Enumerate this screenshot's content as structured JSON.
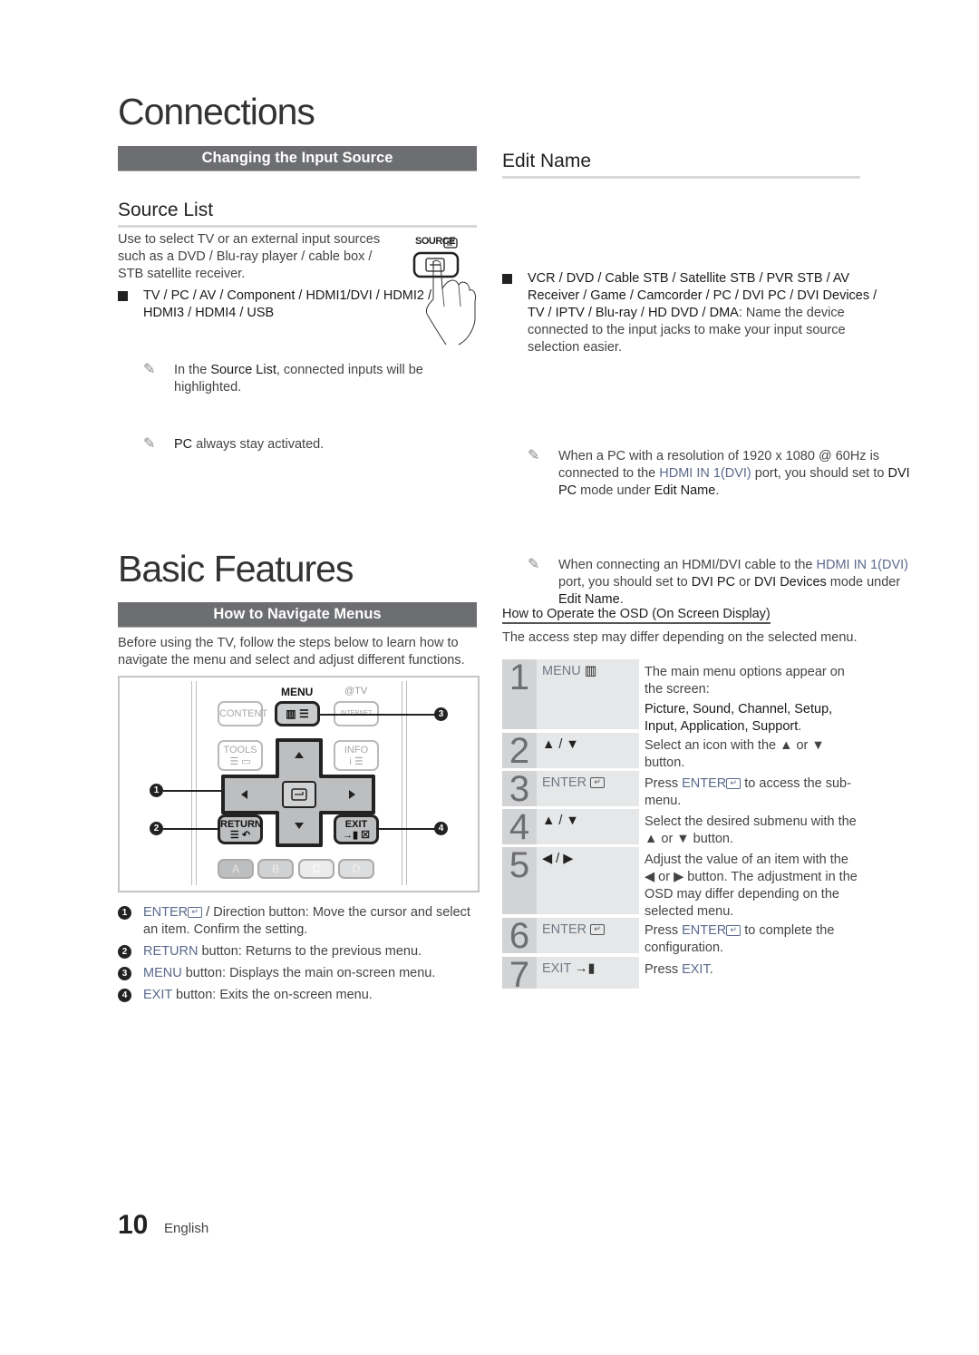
{
  "connections": {
    "title": "Connections",
    "section_bar": "Changing the Input Source",
    "source_list": {
      "heading": "Source List",
      "intro": "Use to select TV or an external input sources such as a DVD / Blu-ray player / cable box / STB satellite receiver.",
      "bullet": "TV / PC / AV / Component / HDMI1/DVI / HDMI2 / HDMI3 / HDMI4 / USB",
      "note1_pre": "In the ",
      "note1_bold": "Source List",
      "note1_post": ", connected inputs will be highlighted.",
      "note2_bold": "PC",
      "note2_post": " always stay activated.",
      "illustration_label": "SOURCE"
    },
    "edit_name": {
      "heading": "Edit Name",
      "bullet_bold": "VCR / DVD / Cable STB / Satellite STB / PVR STB / AV Receiver / Game / Camcorder / PC / DVI PC / DVI Devices / TV / IPTV / Blu-ray / HD DVD / DMA",
      "bullet_post": ": Name the device connected to the input jacks to make your input source selection easier.",
      "note1_a": "When a PC with a resolution of 1920 x 1080 @ 60Hz is connected to the ",
      "note1_port": "HDMI IN 1(DVI)",
      "note1_b": " port, you should set to ",
      "note1_mode": "DVI PC",
      "note1_c": " mode under ",
      "note1_menu": "Edit Name",
      "note1_d": ".",
      "note2_a": "When connecting an HDMI/DVI cable to the ",
      "note2_port": "HDMI IN 1(DVI)",
      "note2_b": " port, you should set to ",
      "note2_mode1": "DVI PC",
      "note2_or": " or ",
      "note2_mode2": "DVI Devices",
      "note2_c": " mode under ",
      "note2_menu": "Edit Name",
      "note2_d": "."
    }
  },
  "basic_features": {
    "title": "Basic Features",
    "section_bar": "How to Navigate Menus",
    "intro": "Before using the TV, follow the steps below to learn how to navigate the menu and select and adjust different functions.",
    "remote": {
      "menu_label": "MENU",
      "attv_label": "@TV",
      "content": "CONTENT",
      "internet": "INTERNET",
      "tools": "TOOLS",
      "info": "INFO",
      "return": "RETURN",
      "exit": "EXIT",
      "color_buttons": [
        "A",
        "B",
        "C",
        "D"
      ],
      "callouts": [
        "1",
        "2",
        "3",
        "4"
      ]
    },
    "legend": [
      {
        "num": "1",
        "key": "ENTER",
        "text": " / Direction button: Move the cursor and select an item. Confirm the setting."
      },
      {
        "num": "2",
        "key": "RETURN",
        "text": " button: Returns to the previous menu."
      },
      {
        "num": "3",
        "key": "MENU",
        "text": " button: Displays the main on-screen menu."
      },
      {
        "num": "4",
        "key": "EXIT",
        "text": " button: Exits the on-screen menu."
      }
    ],
    "osd": {
      "heading": "How to Operate the OSD (On Screen Display)",
      "subtext": "The access step may differ depending on the selected menu.",
      "steps": [
        {
          "num": "1",
          "key": "MENU",
          "desc": "The main menu options appear on the screen:",
          "desc_bold": "Picture, Sound, Channel, Setup, Input, Application, Support",
          "desc_end": "."
        },
        {
          "num": "2",
          "key": "▲ / ▼",
          "desc": "Select an icon with the ▲ or ▼ button."
        },
        {
          "num": "3",
          "key": "ENTER",
          "desc_pre": "Press ",
          "desc_key": "ENTER",
          "desc": " to access the sub-menu."
        },
        {
          "num": "4",
          "key": "▲ / ▼",
          "desc": "Select the desired submenu with the ▲ or ▼ button."
        },
        {
          "num": "5",
          "key": "◀ / ▶",
          "desc": "Adjust the value of an item with the ◀ or ▶ button. The adjustment in the OSD may differ depending on the selected menu."
        },
        {
          "num": "6",
          "key": "ENTER",
          "desc_pre": "Press ",
          "desc_key": "ENTER",
          "desc": " to complete the configuration."
        },
        {
          "num": "7",
          "key": "EXIT",
          "desc_pre": "Press ",
          "desc_key": "EXIT",
          "desc": "."
        }
      ]
    }
  },
  "footer": {
    "page_number": "10",
    "language": "English"
  }
}
